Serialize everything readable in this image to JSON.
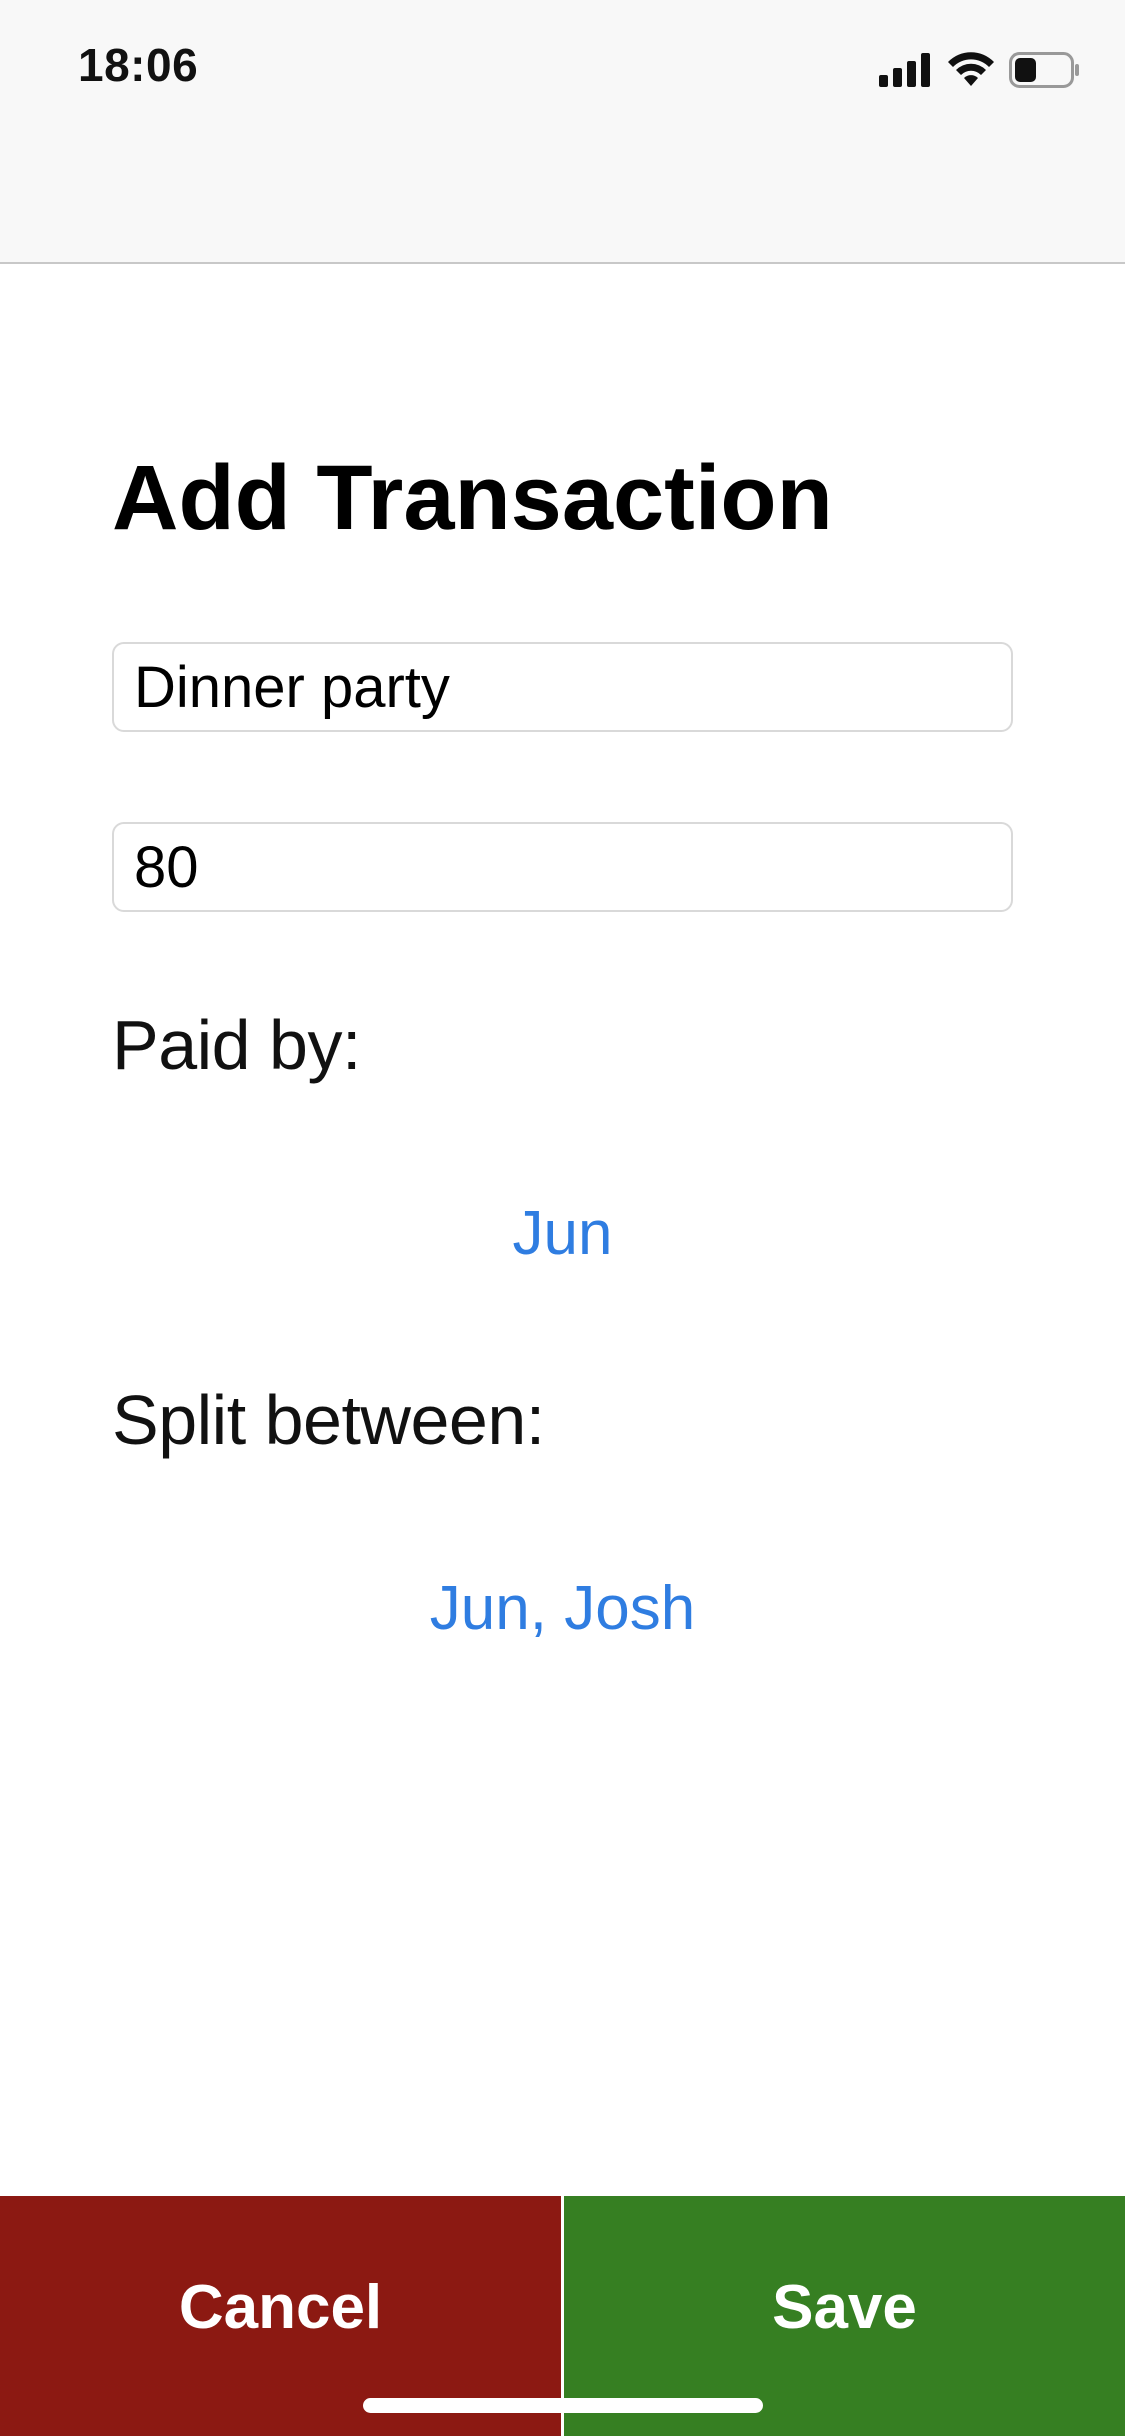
{
  "status_bar": {
    "time": "18:06",
    "icons": [
      "cellular-signal-icon",
      "wifi-icon",
      "battery-icon"
    ],
    "battery_level": 0.4
  },
  "page": {
    "title": "Add Transaction"
  },
  "form": {
    "description_value": "Dinner party",
    "amount_value": "80",
    "paid_by_label": "Paid by:",
    "paid_by_value": "Jun",
    "split_label": "Split between:",
    "split_value": "Jun, Josh"
  },
  "actions": {
    "cancel_label": "Cancel",
    "save_label": "Save"
  },
  "colors": {
    "link": "#2f7de1",
    "cancel": "#8c1912",
    "save": "#367f22"
  }
}
